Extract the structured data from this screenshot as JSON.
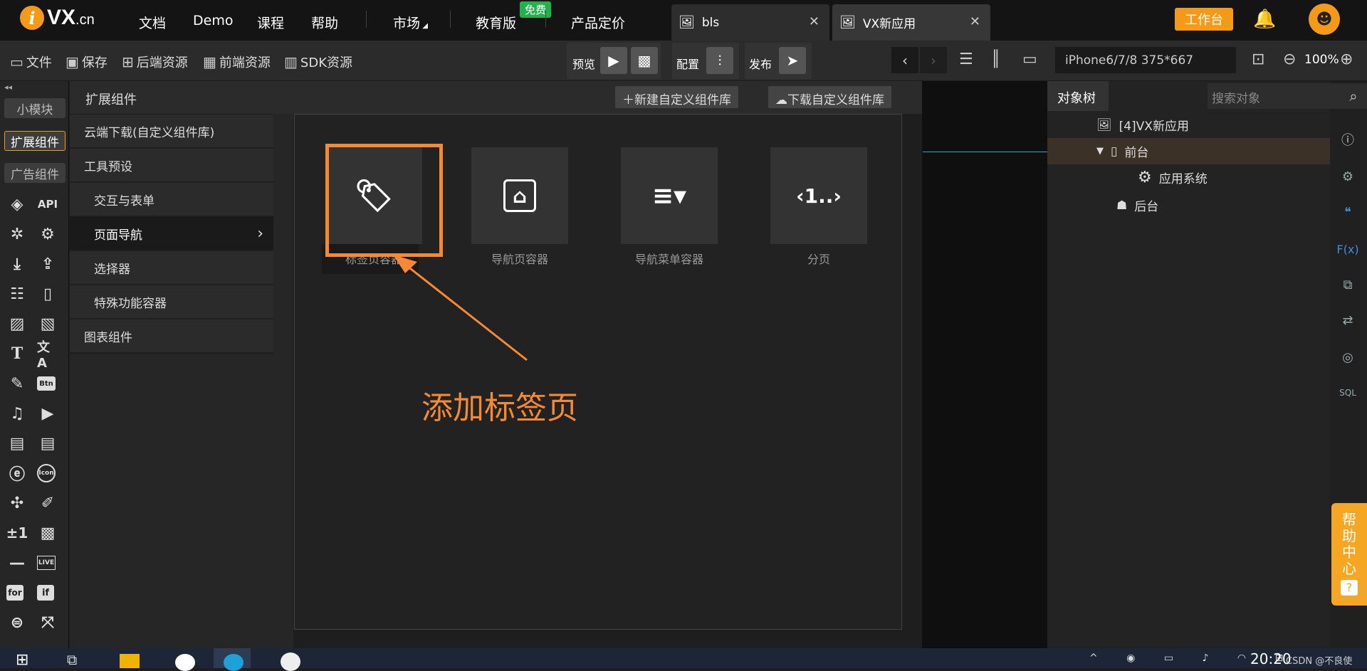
{
  "logo": {
    "mark": "i",
    "text": "VX",
    "suffix": ".cn"
  },
  "nav": {
    "docs": "文档",
    "demo": "Demo",
    "course": "课程",
    "help": "帮助",
    "market": "市场",
    "edu": "教育版",
    "free_badge": "免费",
    "pricing": "产品定价"
  },
  "tabs": [
    {
      "label": "bls"
    },
    {
      "label": "VX新应用"
    }
  ],
  "header": {
    "workbench": "工作台"
  },
  "toolbar": {
    "file": "文件",
    "save": "保存",
    "backend_res": "后端资源",
    "frontend_res": "前端资源",
    "sdk_res": "SDK资源",
    "preview": "预览",
    "config": "配置",
    "publish": "发布",
    "device": "iPhone6/7/8 375*667",
    "zoom": "100%"
  },
  "leftbar": {
    "small_module": "小模块",
    "ext_components": "扩展组件",
    "ad_components": "广告组件",
    "api": "API",
    "btn": "Btn",
    "icon": "Icon",
    "for": "for",
    "if": "if",
    "live": "LIVE",
    "plus_minus": "±1"
  },
  "panel": {
    "title": "扩展组件",
    "new_lib": "新建自定义组件库",
    "download_lib": "下载自定义组件库",
    "categories": [
      {
        "label": "云端下载(自定义组件库)"
      },
      {
        "label": "工具预设"
      },
      {
        "label": "交互与表单"
      },
      {
        "label": "页面导航"
      },
      {
        "label": "选择器"
      },
      {
        "label": "特殊功能容器"
      },
      {
        "label": "图表组件"
      }
    ],
    "components": [
      {
        "label": "标签页容器"
      },
      {
        "label": "导航页容器"
      },
      {
        "label": "导航菜单容器"
      },
      {
        "label": "分页"
      }
    ],
    "annotation": "添加标签页"
  },
  "object_tree": {
    "tab": "对象树",
    "search_placeholder": "搜索对象",
    "nodes": [
      {
        "label": "[4]VX新应用"
      },
      {
        "label": "前台"
      },
      {
        "label": "应用系统"
      },
      {
        "label": "后台"
      }
    ]
  },
  "help_center": "帮助中心",
  "taskbar": {
    "time": "20:20",
    "watermark": "CSDN @不良使"
  },
  "colors": {
    "accent": "#f59a17",
    "annotation": "#f58a32",
    "free": "#22b14c"
  }
}
